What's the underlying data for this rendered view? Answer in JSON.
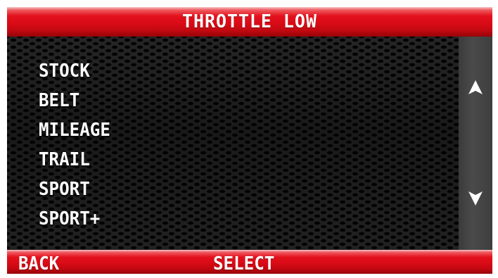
{
  "header": {
    "title": "THROTTLE LOW"
  },
  "menu": {
    "items": [
      {
        "label": "STOCK"
      },
      {
        "label": "BELT"
      },
      {
        "label": "MILEAGE"
      },
      {
        "label": "TRAIL"
      },
      {
        "label": "SPORT"
      },
      {
        "label": "SPORT+"
      }
    ]
  },
  "scrollbar": {
    "up_icon": "triangle-up-icon",
    "down_icon": "triangle-down-icon"
  },
  "footer": {
    "back_label": "BACK",
    "select_label": "SELECT"
  },
  "colors": {
    "accent_red": "#d90b16",
    "background_dark": "#1a1a1a",
    "scrollbar_gray": "#454545",
    "text": "#ffffff"
  }
}
